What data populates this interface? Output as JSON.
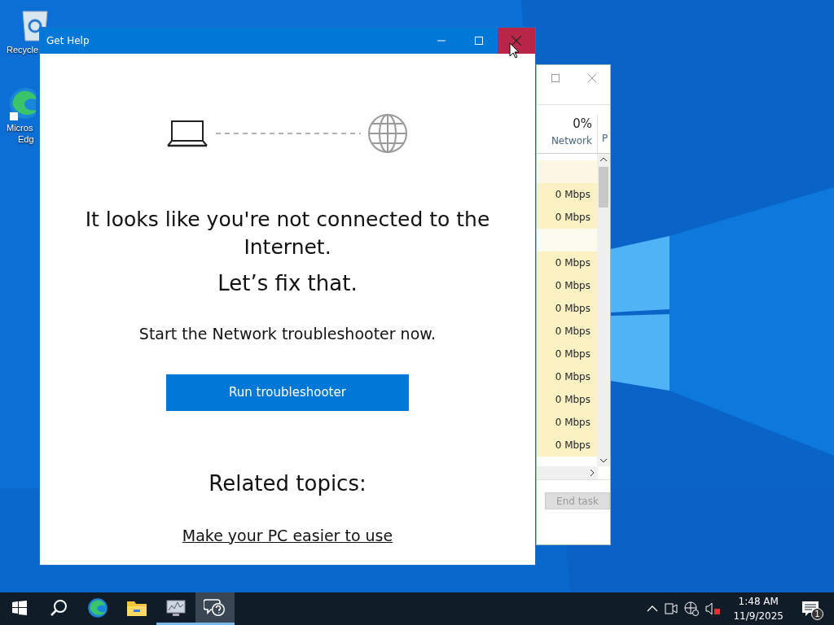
{
  "desktop_icons": [
    {
      "kind": "recycle",
      "lines": [
        "Recycle"
      ]
    },
    {
      "kind": "edge",
      "lines": [
        "Micros",
        "Edg"
      ]
    }
  ],
  "background_window": {
    "cpu_total": "0%",
    "column": "Network",
    "column_2": "P",
    "rows": [
      {
        "kind": "header"
      },
      {
        "kind": "value",
        "value": "0 Mbps"
      },
      {
        "kind": "value",
        "value": "0 Mbps"
      },
      {
        "kind": "blank"
      },
      {
        "kind": "value",
        "value": "0 Mbps"
      },
      {
        "kind": "value",
        "value": "0 Mbps"
      },
      {
        "kind": "value",
        "value": "0 Mbps"
      },
      {
        "kind": "value",
        "value": "0 Mbps"
      },
      {
        "kind": "value",
        "value": "0 Mbps"
      },
      {
        "kind": "value",
        "value": "0 Mbps"
      },
      {
        "kind": "value",
        "value": "0 Mbps"
      },
      {
        "kind": "value",
        "value": "0 Mbps"
      },
      {
        "kind": "value",
        "value": "0 Mbps"
      }
    ],
    "end_task": {
      "label": "End task",
      "disabled": true
    }
  },
  "window": {
    "title": "Get Help",
    "close_hovered": true,
    "heading": "It looks like you're not connected to the Internet.",
    "subheading": "Let’s fix that.",
    "prompt": "Start the Network troubleshooter now.",
    "button": "Run troubleshooter",
    "related_heading": "Related topics:",
    "links": [
      "Make your PC easier to use"
    ]
  },
  "taskbar": {
    "apps": [
      {
        "kind": "start",
        "running": false,
        "selected": false
      },
      {
        "kind": "search",
        "running": false,
        "selected": false
      },
      {
        "kind": "edge",
        "running": false,
        "selected": false
      },
      {
        "kind": "explorer",
        "running": false,
        "selected": false
      },
      {
        "kind": "taskmgr",
        "running": true,
        "selected": false
      },
      {
        "kind": "help",
        "running": true,
        "selected": true
      }
    ],
    "time": "1:48 AM",
    "date": "11/9/2025",
    "notifications": "1"
  }
}
